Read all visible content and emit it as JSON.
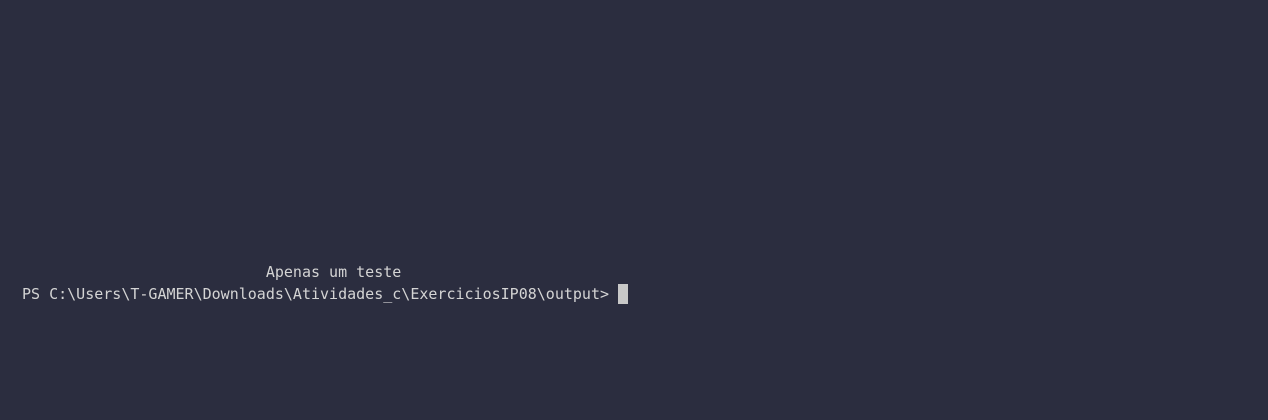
{
  "terminal": {
    "output_text": "                           Apenas um teste",
    "prompt": "PS C:\\Users\\T-GAMER\\Downloads\\Atividades_c\\ExerciciosIP08\\output>"
  }
}
